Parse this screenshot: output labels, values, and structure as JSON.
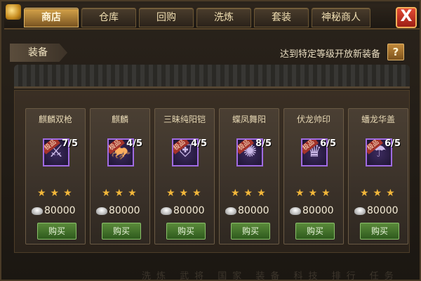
{
  "tabs": [
    {
      "label": "商店",
      "active": true
    },
    {
      "label": "仓库",
      "active": false
    },
    {
      "label": "回购",
      "active": false
    },
    {
      "label": "洗炼",
      "active": false
    },
    {
      "label": "套装",
      "active": false
    },
    {
      "label": "神秘商人",
      "active": false
    }
  ],
  "close_label": "X",
  "section": {
    "label": "装备"
  },
  "notice": "达到特定等级开放新装备",
  "help_label": "?",
  "items": [
    {
      "name": "麒麟双枪",
      "count": "7/5",
      "stars": "★★★",
      "price": "80000",
      "buy": "购买",
      "icon": "axe-icon",
      "quality": "极品",
      "glyph": "⚔"
    },
    {
      "name": "麒麟",
      "count": "4/5",
      "stars": "★★★",
      "price": "80000",
      "buy": "购买",
      "icon": "qilin-mount-icon",
      "quality": "极品",
      "glyph": "🐎"
    },
    {
      "name": "三昧纯阳铠",
      "count": "4/5",
      "stars": "★★★",
      "price": "80000",
      "buy": "购买",
      "icon": "armor-icon",
      "quality": "极品",
      "glyph": "⛨"
    },
    {
      "name": "蝶凤舞阳",
      "count": "8/5",
      "stars": "★★★",
      "price": "80000",
      "buy": "购买",
      "icon": "phoenix-wings-icon",
      "quality": "极品",
      "glyph": "✺"
    },
    {
      "name": "伏龙帅印",
      "count": "6/5",
      "stars": "★★★",
      "price": "80000",
      "buy": "购买",
      "icon": "dragon-seal-icon",
      "quality": "极品",
      "glyph": "♛"
    },
    {
      "name": "蟠龙华盖",
      "count": "6/5",
      "stars": "★★★",
      "price": "80000",
      "buy": "购买",
      "icon": "canopy-icon",
      "quality": "极品",
      "glyph": "☂"
    }
  ],
  "footer": "洗炼 武将 国家 装备 科技 排行 任务",
  "colors": {
    "accent": "#d6a44a",
    "buy_button": "#4a7a2e",
    "quality_border": "#a06be2",
    "star": "#f2b73a"
  }
}
